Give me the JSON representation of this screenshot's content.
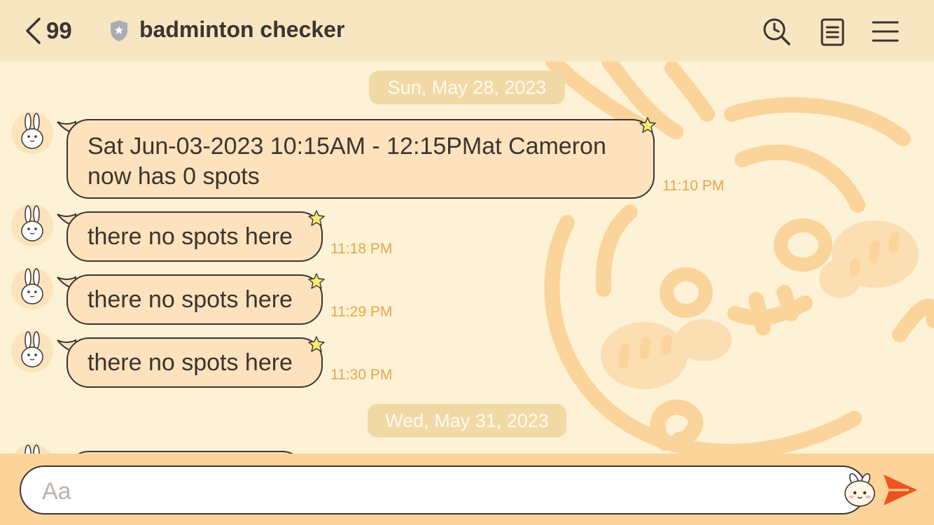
{
  "header": {
    "back_count": "99",
    "title": "badminton checker",
    "icons": [
      "chevron-left-icon",
      "shield-star-icon",
      "search-history-icon",
      "notes-icon",
      "menu-icon"
    ]
  },
  "messages": [
    {
      "text": "Sat Jun-03-2023 10:15AM - 12:15PMat Cameron now has 0 spots",
      "time": "11:10 PM"
    },
    {
      "text": "there no spots here",
      "time": "11:18 PM"
    },
    {
      "text": "there no spots here",
      "time": "11:29 PM"
    },
    {
      "text": "there no spots here",
      "time": "11:30 PM"
    }
  ],
  "dates": [
    "Sun, May 28, 2023",
    "Wed, May 31, 2023"
  ],
  "input": {
    "placeholder": "Aa"
  },
  "colors": {
    "header_bg": "#f8e6c2",
    "chat_bg": "#fdf1d6",
    "bubble": "#fde2bd",
    "time": "#e2a94a",
    "input_bar": "#fdd39a",
    "send": "#f0531e"
  }
}
